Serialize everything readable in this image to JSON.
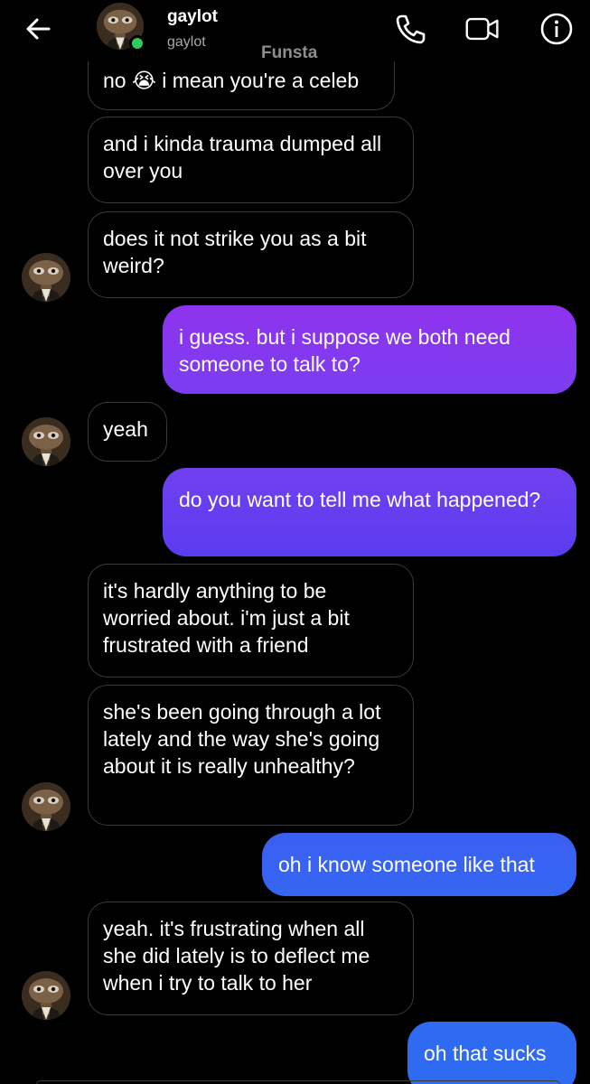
{
  "header": {
    "name": "gaylot",
    "username": "gaylot",
    "watermark": "Funsta",
    "icons": [
      "back-arrow-icon",
      "phone-icon",
      "video-camera-icon",
      "info-icon"
    ]
  },
  "messages": [
    {
      "side": "in",
      "text": "no 😭 i mean you're a celeb"
    },
    {
      "side": "in",
      "text": "and i kinda trauma dumped all over you"
    },
    {
      "side": "in",
      "text": "does it not strike you as a bit weird?"
    },
    {
      "side": "out",
      "text": "i guess. but i suppose we both need someone to talk to?"
    },
    {
      "side": "in",
      "text": "yeah"
    },
    {
      "side": "out",
      "text": "do you want to tell me what happened?"
    },
    {
      "side": "in",
      "text": "it's hardly anything to be worried about. i'm just a bit frustrated with a friend"
    },
    {
      "side": "in",
      "text": "she's been going through a lot lately and the way she's going about it is really unhealthy?"
    },
    {
      "side": "out",
      "text": "oh i know someone like that"
    },
    {
      "side": "in",
      "text": "yeah. it's frustrating when all she did lately is to deflect me when i try to talk to her"
    },
    {
      "side": "out",
      "text": "oh that sucks"
    }
  ],
  "colors": {
    "outgoing_top": "#8f33ee",
    "outgoing_mid": "#5b3cf0",
    "outgoing_bottom": "#2f6bf2",
    "online": "#2ecb5a"
  }
}
